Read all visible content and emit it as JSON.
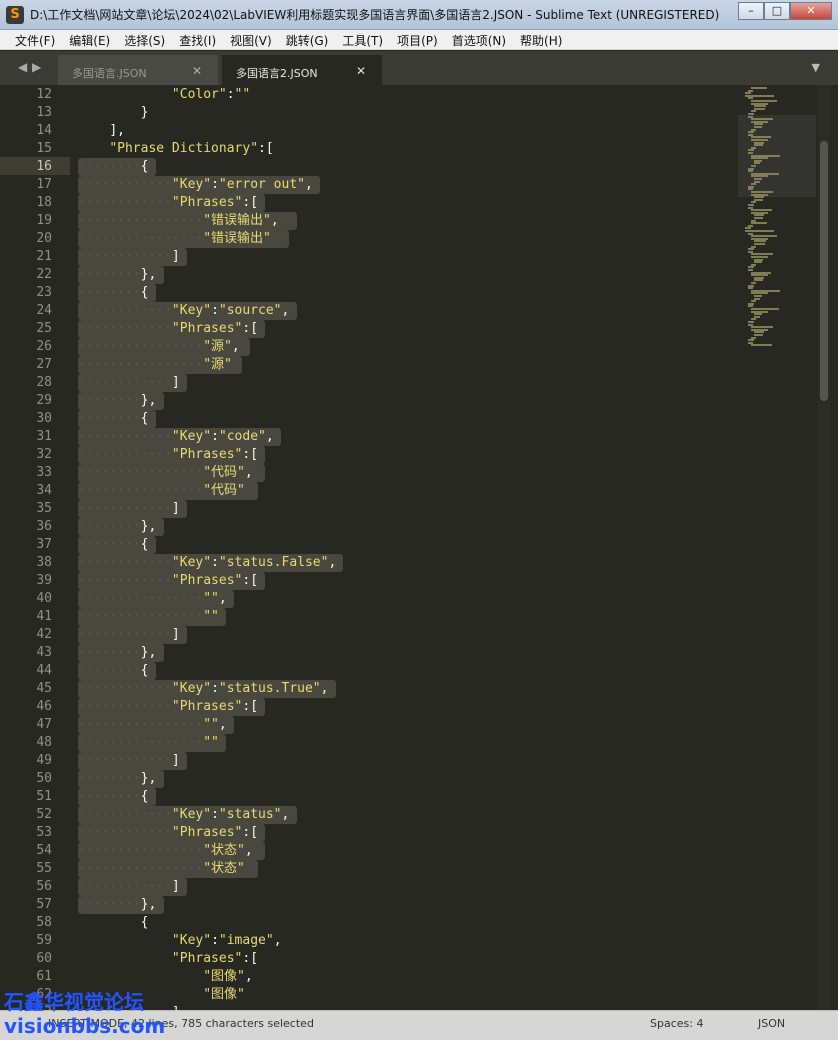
{
  "window": {
    "title": "D:\\工作文档\\网站文章\\论坛\\2024\\02\\LabVIEW利用标题实现多国语言界面\\多国语言2.JSON - Sublime Text (UNREGISTERED)",
    "app_icon": "S"
  },
  "menu": [
    "文件(F)",
    "编辑(E)",
    "选择(S)",
    "查找(I)",
    "视图(V)",
    "跳转(G)",
    "工具(T)",
    "项目(P)",
    "首选项(N)",
    "帮助(H)"
  ],
  "tabs": [
    {
      "label": "多国语言.JSON",
      "active": false
    },
    {
      "label": "多国语言2.JSON",
      "active": true
    }
  ],
  "editor": {
    "first_line": 12,
    "current_line": 16,
    "lines": [
      {
        "indent": 3,
        "text": "\"Color\":\"\""
      },
      {
        "indent": 2,
        "text": "}"
      },
      {
        "indent": 1,
        "text": "],"
      },
      {
        "indent": 1,
        "text": "\"Phrase Dictionary\":["
      },
      {
        "indent": 2,
        "text": "{"
      },
      {
        "indent": 3,
        "text": "\"Key\":\"error out\","
      },
      {
        "indent": 3,
        "text": "\"Phrases\":["
      },
      {
        "indent": 4,
        "text": "\"错误输出\","
      },
      {
        "indent": 4,
        "text": "\"错误输出\""
      },
      {
        "indent": 3,
        "text": "]"
      },
      {
        "indent": 2,
        "text": "},"
      },
      {
        "indent": 2,
        "text": "{"
      },
      {
        "indent": 3,
        "text": "\"Key\":\"source\","
      },
      {
        "indent": 3,
        "text": "\"Phrases\":["
      },
      {
        "indent": 4,
        "text": "\"源\","
      },
      {
        "indent": 4,
        "text": "\"源\""
      },
      {
        "indent": 3,
        "text": "]"
      },
      {
        "indent": 2,
        "text": "},"
      },
      {
        "indent": 2,
        "text": "{"
      },
      {
        "indent": 3,
        "text": "\"Key\":\"code\","
      },
      {
        "indent": 3,
        "text": "\"Phrases\":["
      },
      {
        "indent": 4,
        "text": "\"代码\","
      },
      {
        "indent": 4,
        "text": "\"代码\""
      },
      {
        "indent": 3,
        "text": "]"
      },
      {
        "indent": 2,
        "text": "},"
      },
      {
        "indent": 2,
        "text": "{"
      },
      {
        "indent": 3,
        "text": "\"Key\":\"status.False\","
      },
      {
        "indent": 3,
        "text": "\"Phrases\":["
      },
      {
        "indent": 4,
        "text": "\"\","
      },
      {
        "indent": 4,
        "text": "\"\""
      },
      {
        "indent": 3,
        "text": "]"
      },
      {
        "indent": 2,
        "text": "},"
      },
      {
        "indent": 2,
        "text": "{"
      },
      {
        "indent": 3,
        "text": "\"Key\":\"status.True\","
      },
      {
        "indent": 3,
        "text": "\"Phrases\":["
      },
      {
        "indent": 4,
        "text": "\"\","
      },
      {
        "indent": 4,
        "text": "\"\""
      },
      {
        "indent": 3,
        "text": "]"
      },
      {
        "indent": 2,
        "text": "},"
      },
      {
        "indent": 2,
        "text": "{"
      },
      {
        "indent": 3,
        "text": "\"Key\":\"status\","
      },
      {
        "indent": 3,
        "text": "\"Phrases\":["
      },
      {
        "indent": 4,
        "text": "\"状态\","
      },
      {
        "indent": 4,
        "text": "\"状态\""
      },
      {
        "indent": 3,
        "text": "]"
      },
      {
        "indent": 2,
        "text": "},"
      },
      {
        "indent": 2,
        "text": "{"
      },
      {
        "indent": 3,
        "text": "\"Key\":\"image\","
      },
      {
        "indent": 3,
        "text": "\"Phrases\":["
      },
      {
        "indent": 4,
        "text": "\"图像\","
      },
      {
        "indent": 4,
        "text": "\"图像\""
      },
      {
        "indent": 3,
        "text": "]"
      }
    ],
    "selection": {
      "from_line": 16,
      "to_line": 57
    }
  },
  "status": {
    "mode": "INSERT MODE, 42 lines, 785 characters selected",
    "spaces": "Spaces: 4",
    "syntax": "JSON"
  },
  "watermark": {
    "line1": "石鑫华视觉论坛",
    "line2": "visionbbs.com"
  },
  "colors": {
    "background": "#272822",
    "string": "#e6db74",
    "selection": "#49483e"
  }
}
